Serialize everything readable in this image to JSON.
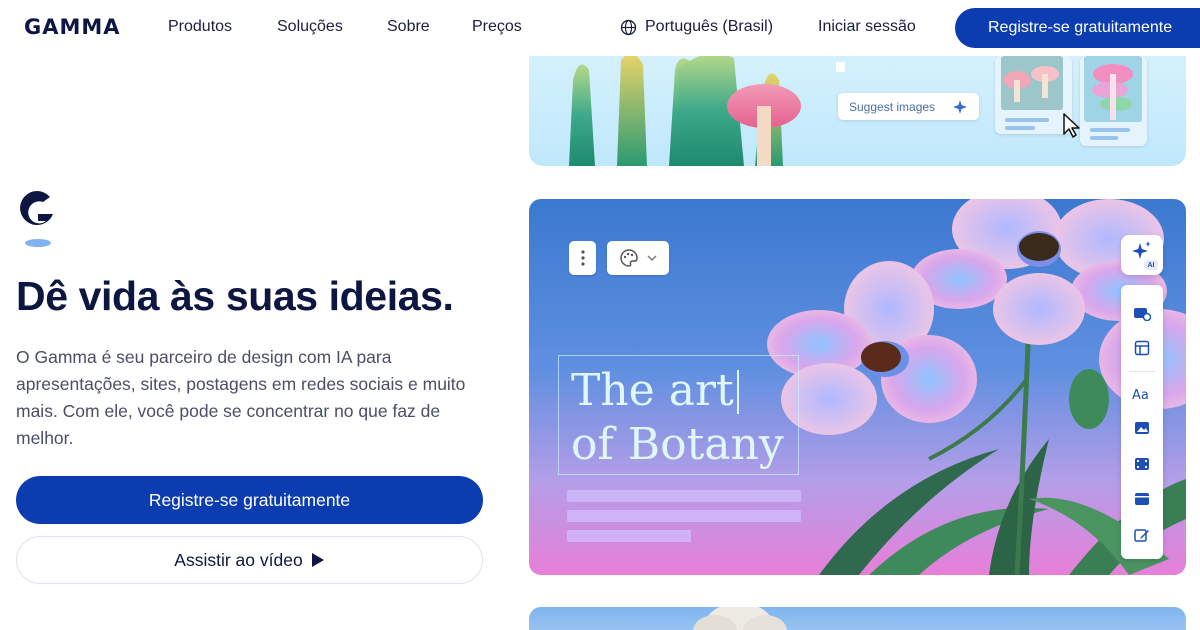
{
  "nav": {
    "logo": "GAMMA",
    "links": [
      "Produtos",
      "Soluções",
      "Sobre",
      "Preços"
    ],
    "language": "Português (Brasil)",
    "signin": "Iniciar sessão",
    "cta": "Registre-se gratuitamente"
  },
  "hero": {
    "title": "Dê vida às suas ideias.",
    "description": "O Gamma é seu parceiro de design com IA para apresentações, sites, postagens em redes sociais e muito mais. Com ele, você pode se concentrar no que faz de melhor.",
    "primary_button": "Registre-se gratuitamente",
    "secondary_button": "Assistir ao vídeo"
  },
  "preview": {
    "suggest_label": "Suggest images",
    "slide_title": "The art\nof Botany",
    "ai_badge": "AI",
    "side_icons": [
      "card-add-icon",
      "layout-icon",
      "text-icon",
      "image-icon",
      "video-icon",
      "embed-icon",
      "edit-icon"
    ]
  },
  "colors": {
    "brand": "#0c3db0",
    "heading": "#0c1640",
    "body_text": "#4b4f66"
  }
}
